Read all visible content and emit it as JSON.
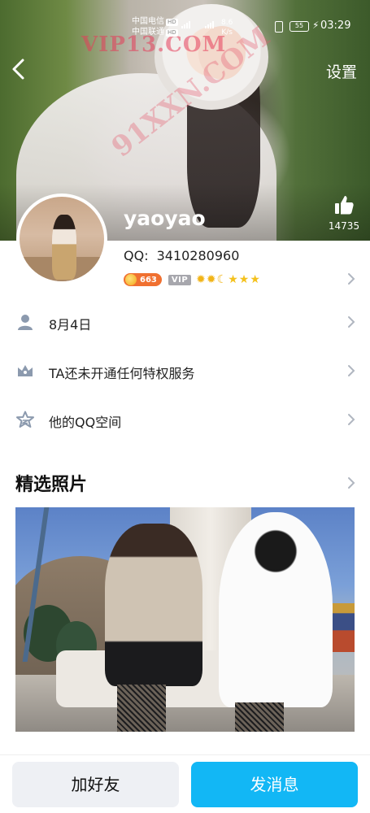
{
  "status_bar": {
    "carrier1": "中国电信",
    "carrier2": "中国联通",
    "hd_badge": "HD",
    "speed_value": "8.6",
    "speed_unit": "K/s",
    "battery": "55",
    "time": "03:29"
  },
  "header": {
    "back_icon": "chevron-left-icon",
    "settings_label": "设置",
    "watermark": "VIP13.COM",
    "watermark2": "91XXN.COM",
    "nickname": "yaoyao",
    "like_icon": "thumbs-up-icon",
    "like_count": "14735"
  },
  "profile": {
    "qq_label": "QQ:",
    "qq_number": "3410280960",
    "level_badge": "663",
    "vip_label": "VIP",
    "level_icons": [
      "sun",
      "sun",
      "moon",
      "star",
      "star",
      "star"
    ]
  },
  "info_rows": [
    {
      "icon": "person-icon",
      "label": "8月4日"
    },
    {
      "icon": "crown-icon",
      "label": "TA还未开通任何特权服务"
    },
    {
      "icon": "star-outline-icon",
      "label": "他的QQ空间"
    }
  ],
  "featured": {
    "title": "精选照片"
  },
  "bottom_bar": {
    "add_friend": "加好友",
    "send_message": "发消息"
  },
  "colors": {
    "accent": "#12b7f5",
    "level_badge": "#f07030",
    "vip_badge": "#a7a7ad",
    "secondary_button": "#eef0f4",
    "icon_gray": "#8c9aae"
  }
}
